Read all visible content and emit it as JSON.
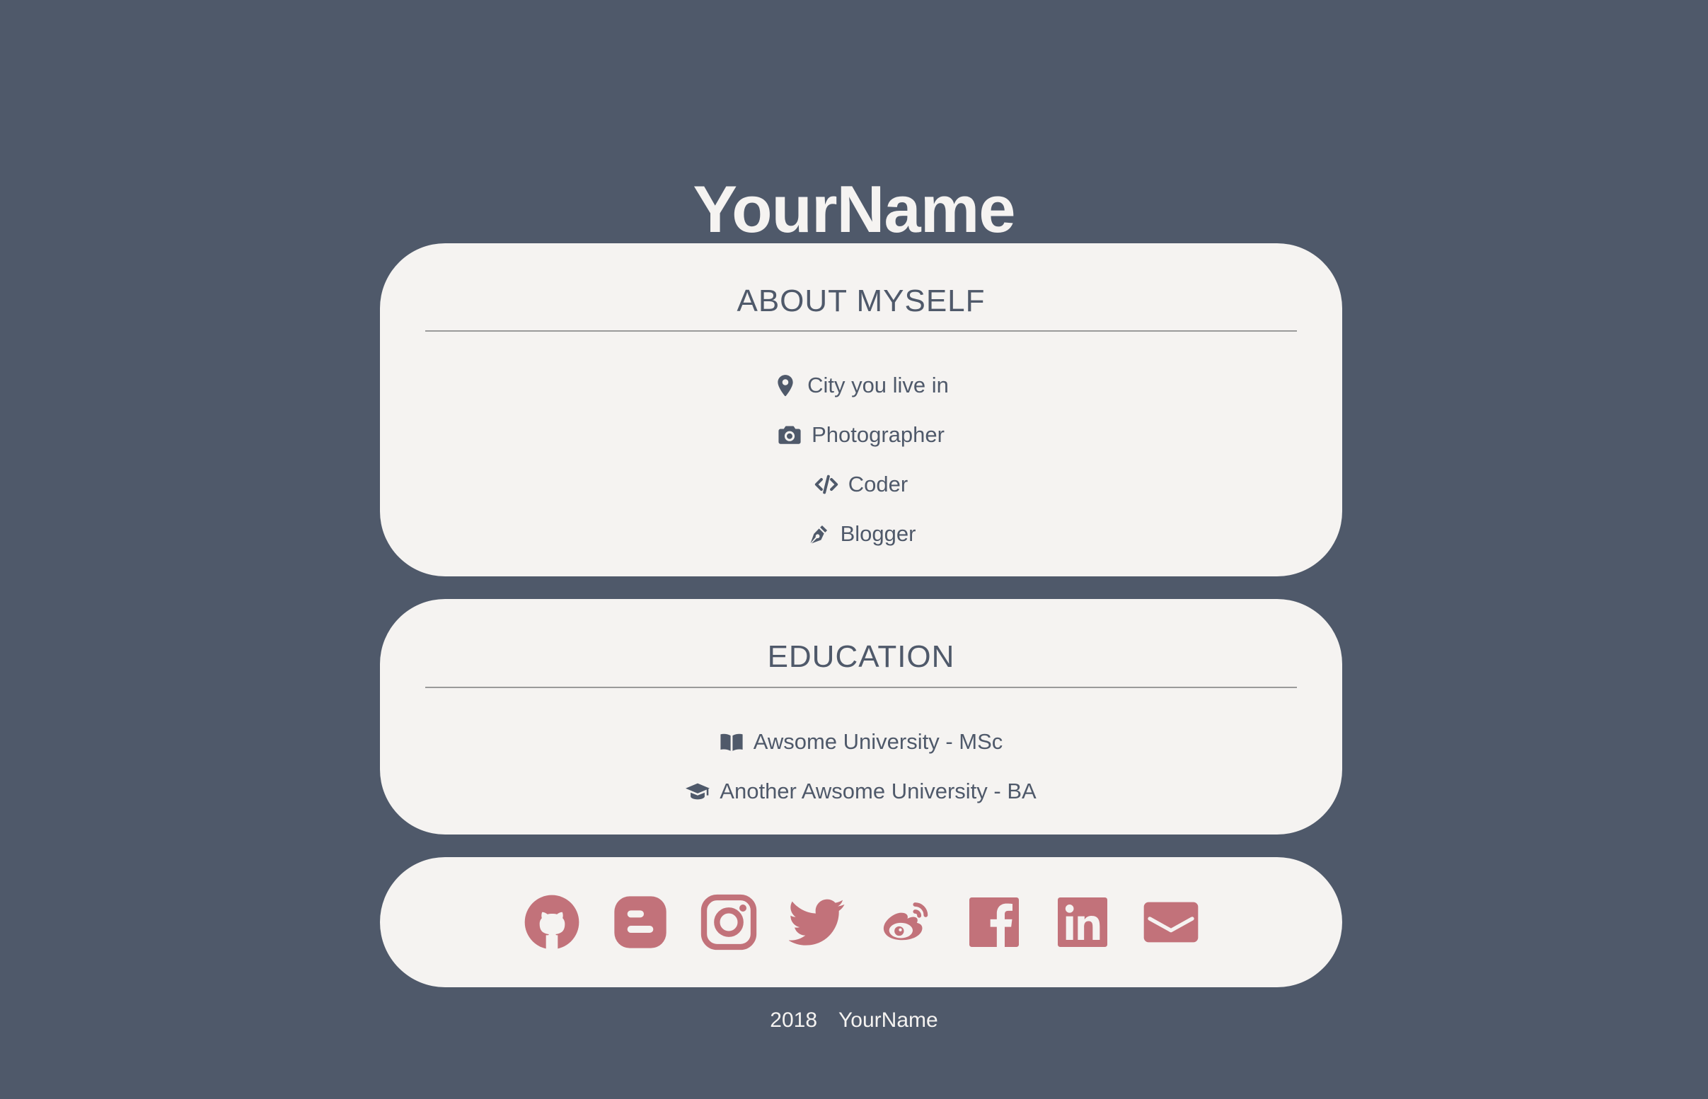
{
  "header": {
    "title": "YourName"
  },
  "about": {
    "heading": "ABOUT MYSELF",
    "items": [
      {
        "icon": "map-marker-icon",
        "label": "City you live in"
      },
      {
        "icon": "camera-icon",
        "label": "Photographer"
      },
      {
        "icon": "code-icon",
        "label": "Coder"
      },
      {
        "icon": "pen-nib-icon",
        "label": "Blogger"
      }
    ]
  },
  "education": {
    "heading": "EDUCATION",
    "items": [
      {
        "icon": "book-open-icon",
        "label": "Awsome University - MSc"
      },
      {
        "icon": "graduation-cap-icon",
        "label": "Another Awsome University - BA"
      }
    ]
  },
  "social": {
    "icons": [
      "github-icon",
      "blogger-icon",
      "instagram-icon",
      "twitter-icon",
      "weibo-icon",
      "facebook-icon",
      "linkedin-icon",
      "email-icon"
    ]
  },
  "footer": {
    "year": "2018",
    "name": "YourName"
  },
  "colors": {
    "background": "#4f596a",
    "card": "#f5f3f1",
    "accent": "#c2727a",
    "text": "#4f596a"
  }
}
